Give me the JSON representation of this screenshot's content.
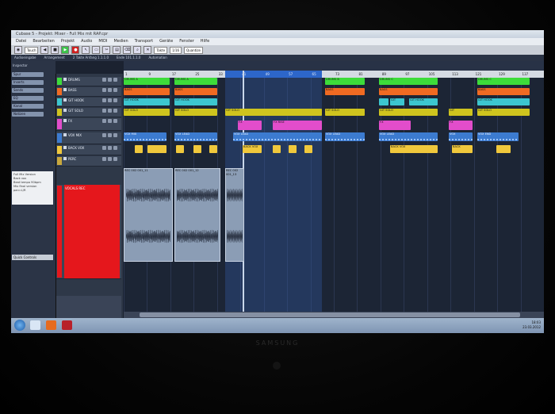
{
  "titlebar": {
    "text": "Cubase 5 - Projekt: Mixer - Full Mix mit RAP.cpr"
  },
  "menu": [
    "Datei",
    "Bearbeiten",
    "Projekt",
    "Audio",
    "MIDI",
    "Medien",
    "Transport",
    "Geräte",
    "Fenster",
    "Hilfe"
  ],
  "toolbar": {
    "field1": "Touch",
    "field2": "Takte",
    "field3": "1/16",
    "field4": "Quantize"
  },
  "infobar": [
    "Audioeingabe",
    "Arrangement",
    "2 Takte Anfang 1.1.1.0",
    "Ende 101.1.1.0",
    "Automation"
  ],
  "inspector": {
    "header": "Inspector",
    "sections": [
      "Spur",
      "Inserts",
      "Sends",
      "EQ",
      "Kanal",
      "Notizen"
    ],
    "notes": [
      "Full Mix Version",
      "Back vox",
      "Beat tempo 90bpm",
      "Mix final version",
      "pan=L/R"
    ],
    "bottom": "Quick Controls"
  },
  "tracks": [
    {
      "name": "DRUMS",
      "color": "#3ddc3a"
    },
    {
      "name": "BASS",
      "color": "#f06a22"
    },
    {
      "name": "GIT HOOK",
      "color": "#3cc6cf"
    },
    {
      "name": "GIT SOLO",
      "color": "#cfc41e"
    },
    {
      "name": "FX",
      "color": "#e24dcb"
    },
    {
      "name": "VOX MIX",
      "color": "#3c7bd0"
    },
    {
      "name": "BACK VOX",
      "color": "#f0c83c"
    },
    {
      "name": "PERC",
      "color": "#c9a83c"
    }
  ],
  "vocal_track": {
    "name": "VOCALS REC"
  },
  "ruler": [
    "1",
    "9",
    "17",
    "25",
    "33",
    "41",
    "49",
    "57",
    "65",
    "73",
    "81",
    "89",
    "97",
    "105",
    "113",
    "121",
    "129",
    "137"
  ],
  "events": [
    {
      "row": 0,
      "cls": "ev-green",
      "l": 0,
      "w": 58,
      "label": "DRUMS A"
    },
    {
      "row": 0,
      "cls": "ev-green",
      "l": 64,
      "w": 54,
      "label": "DRUMS A"
    },
    {
      "row": 0,
      "cls": "ev-green",
      "l": 254,
      "w": 50,
      "label": "DRUMS B"
    },
    {
      "row": 0,
      "cls": "ev-green",
      "l": 322,
      "w": 74,
      "label": "DRUMS C"
    },
    {
      "row": 0,
      "cls": "ev-green",
      "l": 446,
      "w": 66,
      "label": "DRUMS C"
    },
    {
      "row": 1,
      "cls": "ev-orange",
      "l": 0,
      "w": 58,
      "label": "BASS"
    },
    {
      "row": 1,
      "cls": "ev-orange",
      "l": 64,
      "w": 54,
      "label": "BASS"
    },
    {
      "row": 1,
      "cls": "ev-orange",
      "l": 254,
      "w": 50,
      "label": "BASS"
    },
    {
      "row": 1,
      "cls": "ev-orange",
      "l": 322,
      "w": 74,
      "label": "BASS"
    },
    {
      "row": 1,
      "cls": "ev-orange",
      "l": 446,
      "w": 66,
      "label": "BASS"
    },
    {
      "row": 2,
      "cls": "ev-cyan",
      "l": 0,
      "w": 58,
      "label": "GIT HOOK"
    },
    {
      "row": 2,
      "cls": "ev-cyan",
      "l": 64,
      "w": 54,
      "label": "GIT HOOK"
    },
    {
      "row": 2,
      "cls": "ev-cyan",
      "l": 322,
      "w": 12,
      "label": ""
    },
    {
      "row": 2,
      "cls": "ev-cyan",
      "l": 336,
      "w": 18,
      "label": "GIT"
    },
    {
      "row": 2,
      "cls": "ev-cyan",
      "l": 360,
      "w": 36,
      "label": "GIT HOOK"
    },
    {
      "row": 2,
      "cls": "ev-cyan",
      "l": 446,
      "w": 66,
      "label": "GIT HOOK"
    },
    {
      "row": 3,
      "cls": "ev-yellow",
      "l": 0,
      "w": 58,
      "label": "GIT SOLO"
    },
    {
      "row": 3,
      "cls": "ev-yellow",
      "l": 64,
      "w": 54,
      "label": "GIT SOLO"
    },
    {
      "row": 3,
      "cls": "ev-yellow",
      "l": 128,
      "w": 122,
      "label": "GIT SOLO"
    },
    {
      "row": 3,
      "cls": "ev-yellow",
      "l": 254,
      "w": 50,
      "label": "GIT SOLO"
    },
    {
      "row": 3,
      "cls": "ev-yellow",
      "l": 322,
      "w": 74,
      "label": "GIT SOLO"
    },
    {
      "row": 3,
      "cls": "ev-yellow",
      "l": 410,
      "w": 30,
      "label": "GIT"
    },
    {
      "row": 3,
      "cls": "ev-yellow",
      "l": 446,
      "w": 66,
      "label": "GIT SOLO"
    },
    {
      "row": 4,
      "cls": "ev-pink",
      "l": 144,
      "w": 30,
      "label": "FX"
    },
    {
      "row": 4,
      "cls": "ev-pink",
      "l": 188,
      "w": 62,
      "label": "FX RISE"
    },
    {
      "row": 4,
      "cls": "ev-pink",
      "l": 322,
      "w": 40,
      "label": "FX"
    },
    {
      "row": 4,
      "cls": "ev-pink",
      "l": 410,
      "w": 30,
      "label": "FX"
    },
    {
      "row": 5,
      "cls": "ev-blue",
      "l": 0,
      "w": 54,
      "label": "VOX MIX"
    },
    {
      "row": 5,
      "cls": "ev-blue",
      "l": 64,
      "w": 54,
      "label": "VOX LEAD"
    },
    {
      "row": 5,
      "cls": "ev-blue",
      "l": 138,
      "w": 112,
      "label": "VOX LEAD"
    },
    {
      "row": 5,
      "cls": "ev-blue",
      "l": 254,
      "w": 50,
      "label": "VOX LEAD"
    },
    {
      "row": 5,
      "cls": "ev-blue",
      "l": 322,
      "w": 74,
      "label": "VOX LEAD"
    },
    {
      "row": 5,
      "cls": "ev-blue",
      "l": 410,
      "w": 30,
      "label": "VOX"
    },
    {
      "row": 5,
      "cls": "ev-blue",
      "l": 446,
      "w": 52,
      "label": "VOX END"
    },
    {
      "row": 6,
      "cls": "ev-ylw2",
      "l": 14,
      "w": 10,
      "label": ""
    },
    {
      "row": 6,
      "cls": "ev-ylw2",
      "l": 30,
      "w": 24,
      "label": ""
    },
    {
      "row": 6,
      "cls": "ev-ylw2",
      "l": 66,
      "w": 10,
      "label": ""
    },
    {
      "row": 6,
      "cls": "ev-ylw2",
      "l": 88,
      "w": 10,
      "label": ""
    },
    {
      "row": 6,
      "cls": "ev-ylw2",
      "l": 108,
      "w": 10,
      "label": ""
    },
    {
      "row": 6,
      "cls": "ev-ylw2",
      "l": 150,
      "w": 24,
      "label": "BACK VOX"
    },
    {
      "row": 6,
      "cls": "ev-ylw2",
      "l": 188,
      "w": 10,
      "label": ""
    },
    {
      "row": 6,
      "cls": "ev-ylw2",
      "l": 208,
      "w": 10,
      "label": ""
    },
    {
      "row": 6,
      "cls": "ev-ylw2",
      "l": 228,
      "w": 10,
      "label": ""
    },
    {
      "row": 6,
      "cls": "ev-ylw2",
      "l": 336,
      "w": 60,
      "label": "BACK VOX"
    },
    {
      "row": 6,
      "cls": "ev-ylw2",
      "l": 414,
      "w": 26,
      "label": "BACK"
    },
    {
      "row": 6,
      "cls": "ev-ylw2",
      "l": 470,
      "w": 18,
      "label": ""
    }
  ],
  "audio_events": [
    {
      "label": "REC 002 001_11",
      "l": 0,
      "w": 60
    },
    {
      "label": "REC 002 001_12",
      "l": 64,
      "w": 56
    },
    {
      "label": "REC 002 001_13",
      "l": 128,
      "w": 22
    }
  ],
  "taskbar": {
    "time": "18:03",
    "date": "23.03.2012"
  }
}
